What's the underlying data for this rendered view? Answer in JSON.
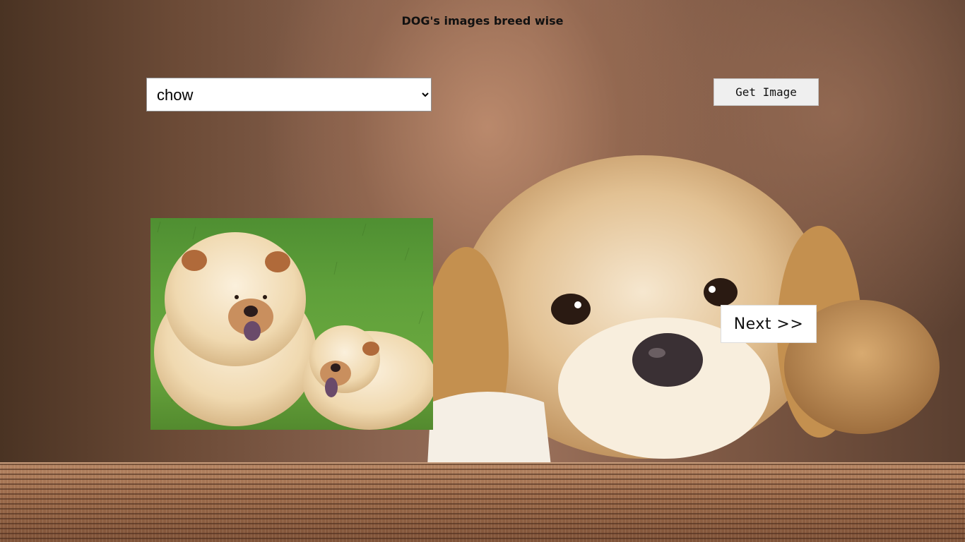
{
  "page": {
    "title": "DOG's images breed wise"
  },
  "controls": {
    "breed_select": {
      "selected": "chow",
      "options": [
        "chow"
      ]
    },
    "get_image_label": "Get Image",
    "next_label": "Next  >>"
  },
  "images": {
    "dog_photo": "dog-photo-chow",
    "background": "puppy-background"
  },
  "colors": {
    "background_brown": "#8a6450",
    "grass_green": "#5fa03a",
    "chow_cream": "#f2dcb4"
  }
}
